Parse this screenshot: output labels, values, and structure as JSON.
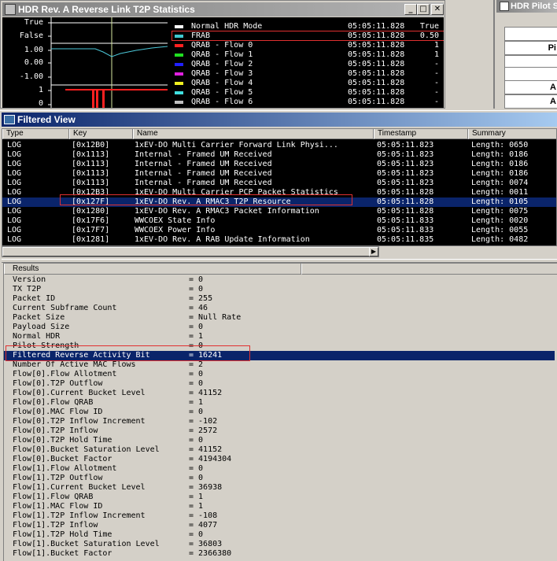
{
  "chart_window": {
    "title": "HDR Rev. A Reverse Link T2P Statistics",
    "buttons": {
      "minimize": "_",
      "maximize": "□",
      "close": "✕"
    },
    "y_labels": [
      "True",
      "False",
      "1.00",
      "0.00",
      "-1.00",
      "1",
      "0"
    ],
    "colors": {
      "frab_line": "#4cc8d8",
      "grid": "#ffffff",
      "cursor": "#d8e8a0",
      "flow0": "#ff2020"
    },
    "legend": [
      {
        "name": "Normal HDR Mode",
        "timestamp": "05:05:11.828",
        "value": "True",
        "color": "#ffffff"
      },
      {
        "name": "FRAB",
        "timestamp": "05:05:11.828",
        "value": "0.50",
        "color": "#40c8d0"
      },
      {
        "name": "QRAB - Flow 0",
        "timestamp": "05:05:11.828",
        "value": "1",
        "color": "#ff2020"
      },
      {
        "name": "QRAB - Flow 1",
        "timestamp": "05:05:11.828",
        "value": "1",
        "color": "#20e020"
      },
      {
        "name": "QRAB - Flow 2",
        "timestamp": "05:05:11.828",
        "value": "-",
        "color": "#2020ff"
      },
      {
        "name": "QRAB - Flow 3",
        "timestamp": "05:05:11.828",
        "value": "-",
        "color": "#e020e0"
      },
      {
        "name": "QRAB - Flow 4",
        "timestamp": "05:05:11.828",
        "value": "-",
        "color": "#f0f020"
      },
      {
        "name": "QRAB - Flow 5",
        "timestamp": "05:05:11.828",
        "value": "-",
        "color": "#40e0e0"
      },
      {
        "name": "QRAB - Flow 6",
        "timestamp": "05:05:11.828",
        "value": "-",
        "color": "#c0c0c0"
      }
    ]
  },
  "pilot_window": {
    "title": "HDR Pilot S",
    "labels": [
      "",
      "Pi",
      "",
      "",
      "A",
      "A"
    ]
  },
  "filtered_view": {
    "title": "Filtered View",
    "columns": [
      "Type",
      "Key",
      "Name",
      "Timestamp",
      "Summary"
    ],
    "rows": [
      {
        "type": "LOG",
        "key": "[0x12B0]",
        "name": "1xEV-DO Multi Carrier Forward Link Physi...",
        "timestamp": "05:05:11.823",
        "summary": "Length: 0650"
      },
      {
        "type": "LOG",
        "key": "[0x1113]",
        "name": "Internal - Framed UM Received",
        "timestamp": "05:05:11.823",
        "summary": "Length: 0186"
      },
      {
        "type": "LOG",
        "key": "[0x1113]",
        "name": "Internal - Framed UM Received",
        "timestamp": "05:05:11.823",
        "summary": "Length: 0186"
      },
      {
        "type": "LOG",
        "key": "[0x1113]",
        "name": "Internal - Framed UM Received",
        "timestamp": "05:05:11.823",
        "summary": "Length: 0186"
      },
      {
        "type": "LOG",
        "key": "[0x1113]",
        "name": "Internal - Framed UM Received",
        "timestamp": "05:05:11.823",
        "summary": "Length: 0074"
      },
      {
        "type": "LOG",
        "key": "[0x12B3]",
        "name": "1xEV-DO Multi Carrier PCP Packet Statistics",
        "timestamp": "05:05:11.828",
        "summary": "Length: 0011"
      },
      {
        "type": "LOG",
        "key": "[0x127F]",
        "name": "1xEV-DO Rev. A RMAC3 T2P Resource",
        "timestamp": "05:05:11.828",
        "summary": "Length: 0105",
        "selected": true
      },
      {
        "type": "LOG",
        "key": "[0x1280]",
        "name": "1xEV-DO Rev. A RMAC3 Packet Information",
        "timestamp": "05:05:11.828",
        "summary": "Length: 0075"
      },
      {
        "type": "LOG",
        "key": "[0x17F6]",
        "name": "WWCOEX State Info",
        "timestamp": "05:05:11.833",
        "summary": "Length: 0020"
      },
      {
        "type": "LOG",
        "key": "[0x17F7]",
        "name": "WWCOEX Power Info",
        "timestamp": "05:05:11.833",
        "summary": "Length: 0055"
      },
      {
        "type": "LOG",
        "key": "[0x1281]",
        "name": "1xEV-DO Rev. A RAB Update Information",
        "timestamp": "05:05:11.835",
        "summary": "Length: 0482"
      }
    ],
    "scroll_arrow": "▶"
  },
  "results": {
    "header": "Results",
    "rows": [
      {
        "k": "Version",
        "v": "= 0"
      },
      {
        "k": "TX T2P",
        "v": "= 0"
      },
      {
        "k": "Packet ID",
        "v": "= 255"
      },
      {
        "k": "Current Subframe Count",
        "v": "= 46"
      },
      {
        "k": "Packet Size",
        "v": "= Null Rate"
      },
      {
        "k": "Payload Size",
        "v": "= 0"
      },
      {
        "k": "Normal HDR",
        "v": "= 1"
      },
      {
        "k": "Pilot Strength",
        "v": "= 0"
      },
      {
        "k": "Filtered Reverse Activity Bit",
        "v": "= 16241",
        "selected": true
      },
      {
        "k": "Number Of Active MAC Flows",
        "v": "= 2"
      },
      {
        "k": "Flow[0].Flow Allotment",
        "v": "= 0"
      },
      {
        "k": "Flow[0].T2P Outflow",
        "v": "= 0"
      },
      {
        "k": "Flow[0].Current Bucket Level",
        "v": "= 41152"
      },
      {
        "k": "Flow[0].Flow QRAB",
        "v": "= 1"
      },
      {
        "k": "Flow[0].MAC Flow ID",
        "v": "= 0"
      },
      {
        "k": "Flow[0].T2P Inflow Increment",
        "v": "= -102"
      },
      {
        "k": "Flow[0].T2P Inflow",
        "v": "= 2572"
      },
      {
        "k": "Flow[0].T2P Hold Time",
        "v": "= 0"
      },
      {
        "k": "Flow[0].Bucket Saturation Level",
        "v": "= 41152"
      },
      {
        "k": "Flow[0].Bucket Factor",
        "v": "= 4194304"
      },
      {
        "k": "Flow[1].Flow Allotment",
        "v": "= 0"
      },
      {
        "k": "Flow[1].T2P Outflow",
        "v": "= 0"
      },
      {
        "k": "Flow[1].Current Bucket Level",
        "v": "= 36938"
      },
      {
        "k": "Flow[1].Flow QRAB",
        "v": "= 1"
      },
      {
        "k": "Flow[1].MAC Flow ID",
        "v": "= 1"
      },
      {
        "k": "Flow[1].T2P Inflow Increment",
        "v": "= -108"
      },
      {
        "k": "Flow[1].T2P Inflow",
        "v": "= 4077"
      },
      {
        "k": "Flow[1].T2P Hold Time",
        "v": "= 0"
      },
      {
        "k": "Flow[1].Bucket Saturation Level",
        "v": "= 36803"
      },
      {
        "k": "Flow[1].Bucket Factor",
        "v": "= 2366380"
      }
    ]
  }
}
